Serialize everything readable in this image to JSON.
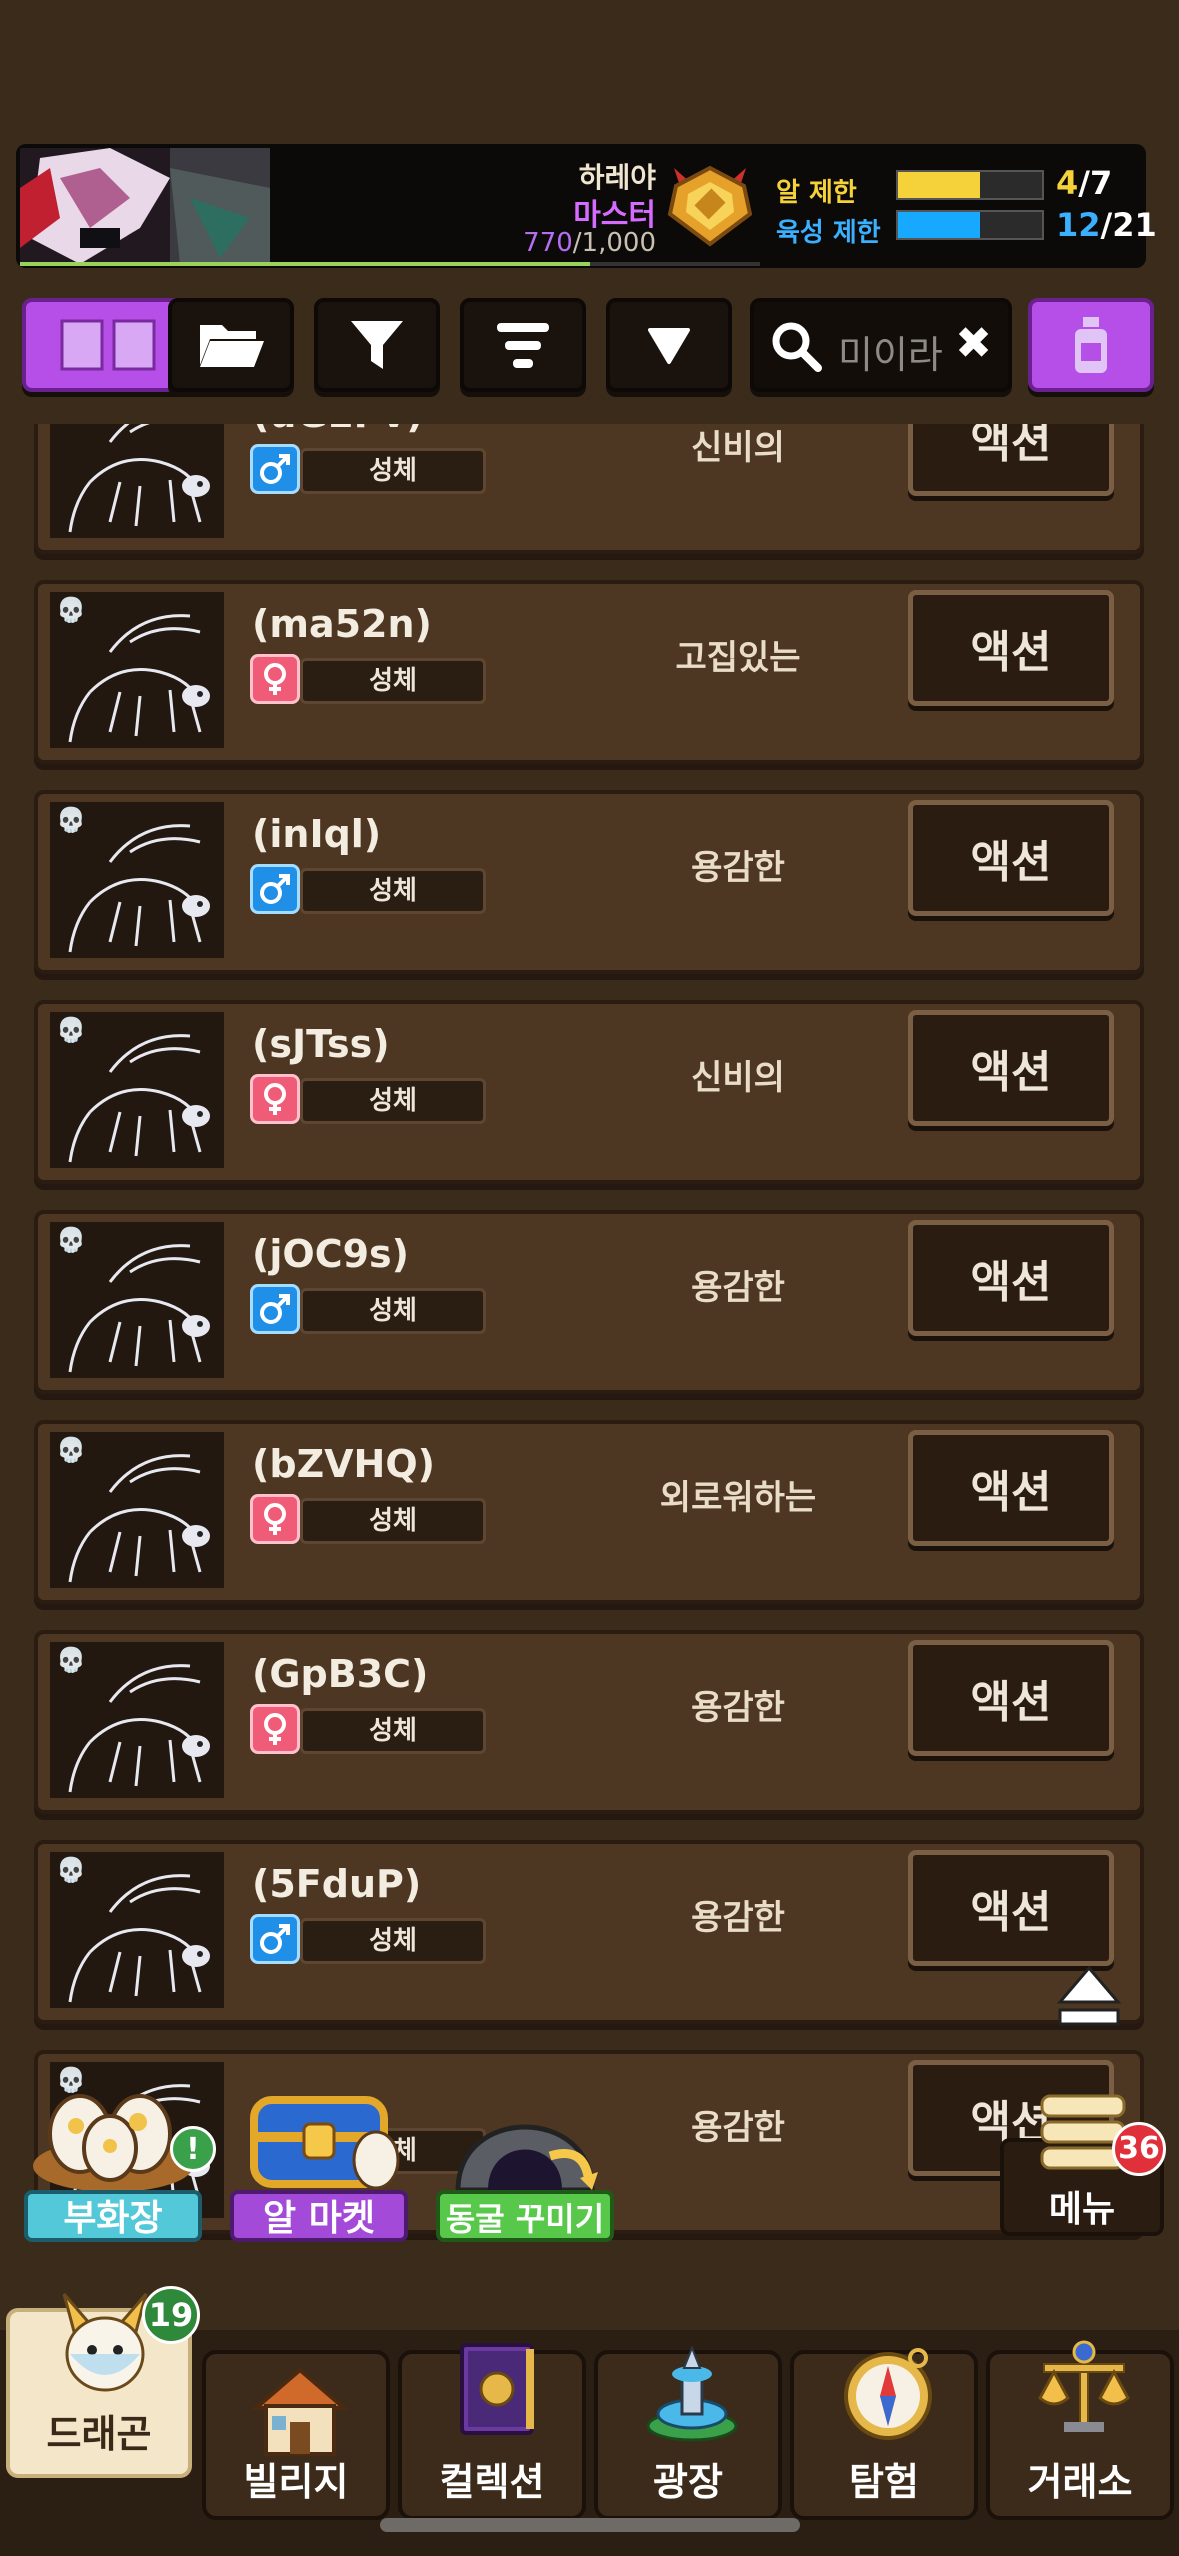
{
  "header": {
    "player_name": "하레야",
    "player_title": "마스터",
    "exp_current": "770",
    "exp_max": "/1,000",
    "exp_fraction": 0.77,
    "egg_limit_label": "알 제한",
    "egg_limit_current": "4",
    "egg_limit_max": "/7",
    "egg_limit_fraction": 0.57,
    "breed_limit_label": "육성 제한",
    "breed_limit_current": "12",
    "breed_limit_max": "/21",
    "breed_limit_fraction": 0.57
  },
  "toolbar": {
    "search_placeholder": "미이라",
    "clear_symbol": "✖"
  },
  "rows": [
    {
      "name": "(uGEPv)",
      "gender": "male",
      "stage": "성체",
      "trait": "신비의",
      "action": "액션"
    },
    {
      "name": "(ma52n)",
      "gender": "female",
      "stage": "성체",
      "trait": "고집있는",
      "action": "액션"
    },
    {
      "name": "(inIql)",
      "gender": "male",
      "stage": "성체",
      "trait": "용감한",
      "action": "액션"
    },
    {
      "name": "(sJTss)",
      "gender": "female",
      "stage": "성체",
      "trait": "신비의",
      "action": "액션"
    },
    {
      "name": "(jOC9s)",
      "gender": "male",
      "stage": "성체",
      "trait": "용감한",
      "action": "액션"
    },
    {
      "name": "(bZVHQ)",
      "gender": "female",
      "stage": "성체",
      "trait": "외로워하는",
      "action": "액션"
    },
    {
      "name": "(GpB3C)",
      "gender": "female",
      "stage": "성체",
      "trait": "용감한",
      "action": "액션"
    },
    {
      "name": "(5FduP)",
      "gender": "male",
      "stage": "성체",
      "trait": "용감한",
      "action": "액션"
    },
    {
      "name": "",
      "gender": "male",
      "stage": "성체",
      "trait": "용감한",
      "action": "액션"
    }
  ],
  "floating": {
    "incubator_label": "부화장",
    "incubator_badge": "!",
    "egg_market_label": "알 마켓",
    "cave_deco_label": "동굴 꾸미기",
    "menu_label": "메뉴",
    "menu_badge": "36"
  },
  "nav": {
    "dragon_label": "드래곤",
    "dragon_badge": "19",
    "village_label": "빌리지",
    "collection_label": "컬렉션",
    "plaza_label": "광장",
    "explore_label": "탐험",
    "exchange_label": "거래소"
  },
  "colors": {
    "background": "#3b2b1b",
    "row_bg": "#4e3722",
    "accent_purple": "#b54fe8",
    "male": "#1f8fe8",
    "female": "#f05b78",
    "egg_bar": "#f5d13a",
    "breed_bar": "#17a9ff"
  }
}
